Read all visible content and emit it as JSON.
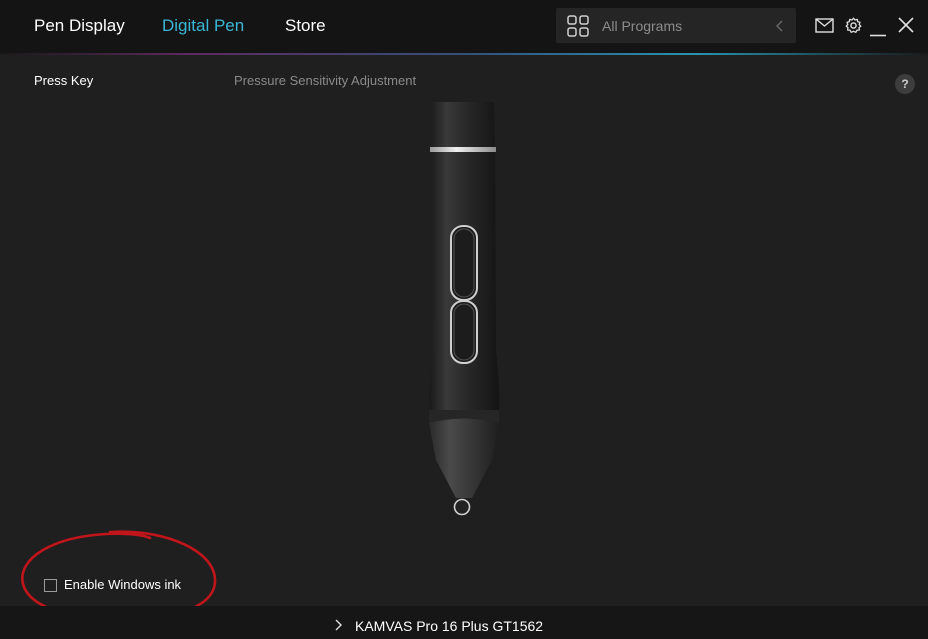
{
  "nav": {
    "tabs": [
      {
        "label": "Pen Display",
        "active": false
      },
      {
        "label": "Digital Pen",
        "active": true
      },
      {
        "label": "Store",
        "active": false
      }
    ]
  },
  "programs": {
    "label": "All Programs"
  },
  "subtabs": {
    "press_key": "Press Key",
    "pressure": "Pressure Sensitivity Adjustment"
  },
  "help": {
    "label": "?"
  },
  "options": {
    "windows_ink_label": "Enable Windows ink",
    "windows_ink_checked": false
  },
  "device": {
    "name": "KAMVAS Pro 16 Plus GT1562"
  },
  "colors": {
    "accent": "#3bb6d6",
    "background": "#1f1f1f",
    "titlebar": "#141414",
    "annotation": "#c0151a"
  },
  "icons": {
    "programs": "grid-icon",
    "collapse": "chevron-left-icon",
    "mail": "mail-icon",
    "settings": "gear-icon",
    "minimize": "minimize-icon",
    "close": "close-icon",
    "device": "chevron-right-icon"
  }
}
